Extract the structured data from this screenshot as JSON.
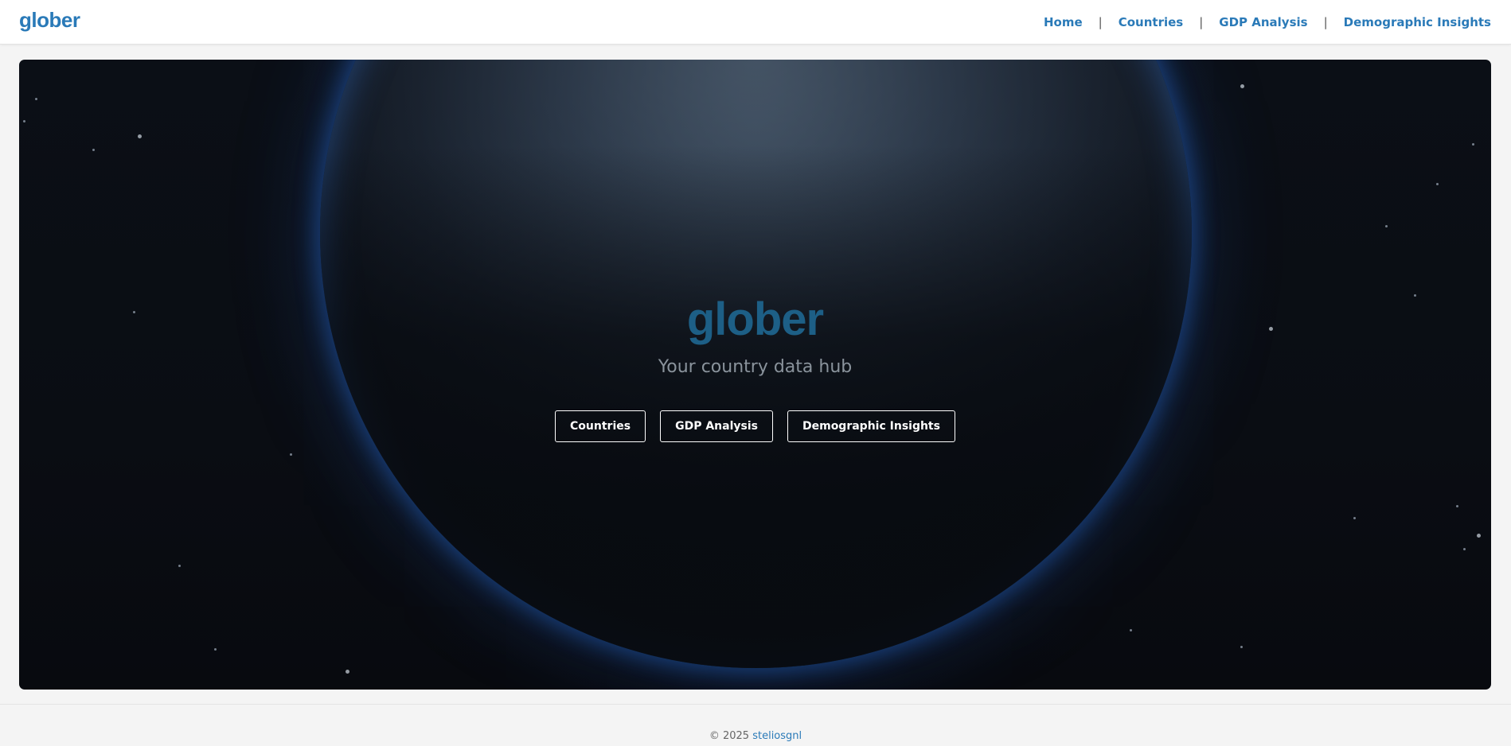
{
  "header": {
    "brand": "glober",
    "nav": [
      {
        "label": "Home"
      },
      {
        "label": "Countries"
      },
      {
        "label": "GDP Analysis"
      },
      {
        "label": "Demographic Insights"
      }
    ],
    "separator": "|",
    "link_color": "#2a7ab8"
  },
  "hero": {
    "title": "glober",
    "subtitle": "Your country data hub",
    "buttons": [
      {
        "label": "Countries"
      },
      {
        "label": "GDP Analysis"
      },
      {
        "label": "Demographic Insights"
      }
    ],
    "title_color": "#1d5f86",
    "background_image": "earth-from-space"
  },
  "footer": {
    "copyright": "© 2025",
    "author_link": "steliosgnl"
  }
}
